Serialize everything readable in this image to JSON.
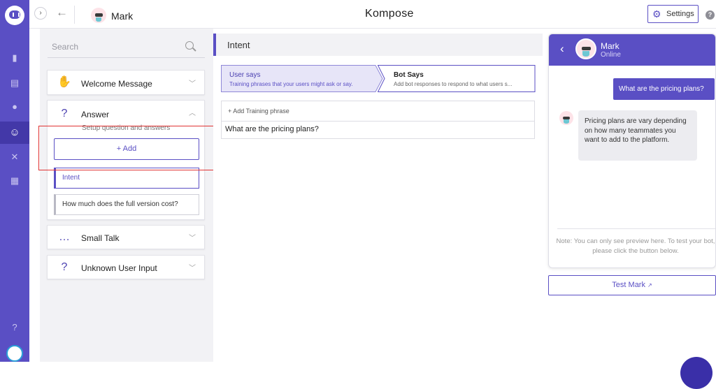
{
  "rail": {
    "icons": [
      "logo-icon",
      "bar-chart-icon",
      "conversations-icon",
      "users-icon",
      "bot-icon",
      "integrations-icon",
      "docs-icon",
      "help-icon",
      "user-avatar"
    ]
  },
  "topbar": {
    "bot_name": "Mark",
    "title": "Kompose",
    "settings_label": "Settings"
  },
  "left": {
    "search_placeholder": "Search",
    "welcome": "Welcome Message",
    "answer": "Answer",
    "answer_sub": "Setup question and answers",
    "add_label": "+ Add",
    "intent_item": "Intent",
    "question_item": "How much does the full version cost?",
    "small_talk": "Small Talk",
    "unknown": "Unknown User Input"
  },
  "middle": {
    "header": "Intent",
    "tab_user_title": "User says",
    "tab_user_sub": "Training phrases that your users might ask or say.",
    "tab_bot_title": "Bot Says",
    "tab_bot_sub": "Add bot responses to respond to what users s...",
    "add_phrase": "+ Add Training phrase",
    "phrases": [
      "What are the pricing plans?"
    ]
  },
  "preview": {
    "name": "Mark",
    "status": "Online",
    "user_msg": "What are the pricing plans?",
    "bot_msg": "Pricing plans are vary depending on how many teammates you want to add to the platform.",
    "note": "Note: You can only see preview here. To test your bot, please click the button below.",
    "test_label": "Test Mark"
  },
  "colors": {
    "accent": "#5a4fc4",
    "highlight": "#e03232"
  }
}
